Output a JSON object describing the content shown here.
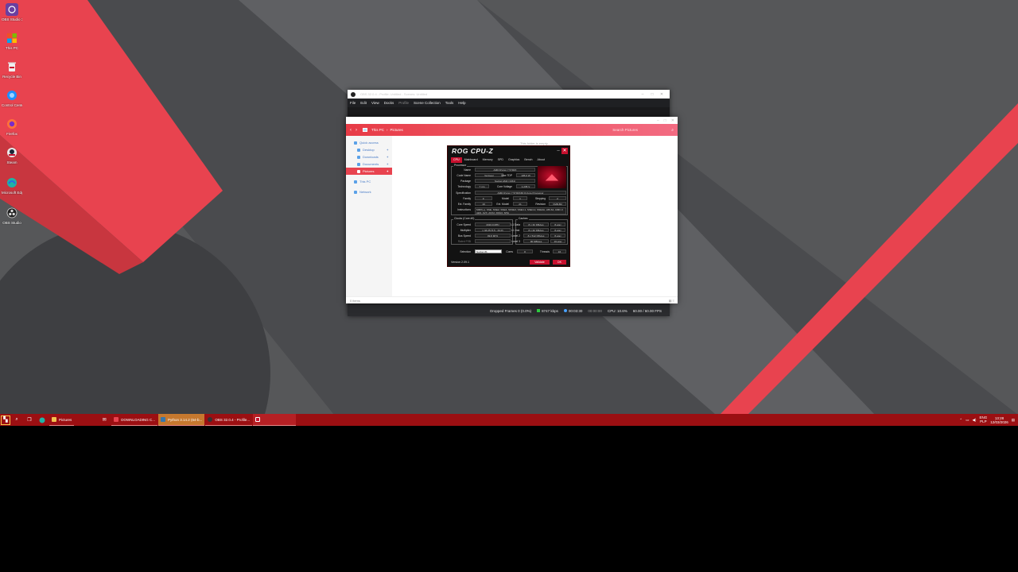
{
  "desktop": {
    "icons": [
      {
        "label": "OBS Studio 32",
        "name": "obs-desktop",
        "color": "#6b3fa0"
      },
      {
        "label": "This PC",
        "name": "this-pc",
        "color": "#f2a81d"
      },
      {
        "label": "Recycle Bin",
        "name": "recycle-bin",
        "color": "#e8e8e8"
      },
      {
        "label": "Control Center",
        "name": "control-center",
        "color": "#1e90ff"
      },
      {
        "label": "Firefox",
        "name": "firefox",
        "color": "#ff7139"
      },
      {
        "label": "Steam",
        "name": "steam",
        "color": "#1b2838"
      },
      {
        "label": "Microsoft Edge",
        "name": "edge",
        "color": "#1fb3a6"
      },
      {
        "label": "OBS Studio",
        "name": "obs-studio",
        "color": "#222"
      }
    ]
  },
  "obs": {
    "title": "OBS 32.0.4 - Profile: Untitled - Scenes: Untitled",
    "menu": [
      "File",
      "Edit",
      "View",
      "Docks",
      "Profile",
      "Scene Collection",
      "Tools",
      "Help"
    ],
    "status": {
      "dropped": "Dropped Frames 0 (0.0%)",
      "bitrate": "8747 kbps",
      "rec_time": "00:03:30",
      "stream_time": "00:00:00",
      "cpu": "CPU: 10.6%",
      "fps": "60.00 / 60.00 FPS"
    }
  },
  "explorer": {
    "path": [
      "This PC",
      "Pictures"
    ],
    "search_placeholder": "Search Pictures",
    "sidebar": [
      {
        "label": "Quick access",
        "sub": false,
        "pin": false,
        "active": false
      },
      {
        "label": "Desktop",
        "sub": true,
        "pin": true,
        "active": false
      },
      {
        "label": "Downloads",
        "sub": true,
        "pin": true,
        "active": false
      },
      {
        "label": "Documents",
        "sub": true,
        "pin": true,
        "active": false
      },
      {
        "label": "Pictures",
        "sub": true,
        "pin": true,
        "active": true
      },
      {
        "label": "This PC",
        "sub": false,
        "pin": false,
        "active": false
      },
      {
        "label": "Network",
        "sub": false,
        "pin": false,
        "active": false
      }
    ],
    "empty_message": "This folder is empty.",
    "status": "0 items"
  },
  "cpuz": {
    "title": "ROG CPU-Z",
    "tabs": [
      "CPU",
      "Mainboard",
      "Memory",
      "SPD",
      "Graphics",
      "Bench",
      "About"
    ],
    "processor_label": "Processor",
    "name_label": "Name",
    "name": "AMD Ryzen 7 5700X",
    "codename_label": "Code Name",
    "codename": "Vermeer",
    "maxtdp_label": "Max TDP",
    "maxtdp": "105.0 W",
    "package_label": "Package",
    "package": "Socket AM4 (1331)",
    "technology_label": "Technology",
    "technology": "7 nm",
    "voltage_label": "Core Voltage",
    "voltage": "1.235 V",
    "spec_label": "Specification",
    "spec": "AMD Ryzen 7 5700X3D 8-Core Processor",
    "family_label": "Family",
    "family": "F",
    "model_label": "Model",
    "model": "1",
    "stepping_label": "Stepping",
    "stepping": "2",
    "extfamily_label": "Ext. Family",
    "extfamily": "19",
    "extmodel_label": "Ext. Model",
    "extmodel": "21",
    "revision_label": "Revision",
    "revision": "VMR-B2",
    "instr_label": "Instructions",
    "instr": "MMX(+), SSE, SSE2, SSE3, SSSE3, SSE4.1, SSE4.2, SSE4A, x86-64, AMD-V, AES, AVX, AVX2, FMA3, SHA",
    "clocks_label": "Clocks (Core #0)",
    "corespeed_label": "Core Speed",
    "corespeed": "4316.9 MHz",
    "multiplier_label": "Multiplier",
    "multiplier": "x 43.25 (5.5 - 34.0)",
    "busspeed_label": "Bus Speed",
    "busspeed": "99.8 MHz",
    "ratedfsb_label": "Rated FSB",
    "caches_label": "Caches",
    "l1d_label": "L1 Data",
    "l1d": "8 x 32 KBytes",
    "l1d_way": "8-way",
    "l1i_label": "L1 Inst.",
    "l1i": "8 x 32 KBytes",
    "l1i_way": "8-way",
    "l2_label": "Level 2",
    "l2": "8 x 512 KBytes",
    "l2_way": "8-way",
    "l3_label": "Level 3",
    "l3": "96 MBytes",
    "l3_way": "16-way",
    "selection_label": "Selection",
    "selection": "Socket #1",
    "cores_label": "Cores",
    "cores": "8",
    "threads_label": "Threads",
    "threads": "16",
    "version": "Version 2.09.1",
    "validate": "Validate",
    "ok": "OK"
  },
  "taskbar": {
    "apps": [
      {
        "label": "Pictures",
        "color": "#f2c14e",
        "style": ""
      },
      {
        "label": "DOWNLOADING C...",
        "color": "#e8434f",
        "style": ""
      },
      {
        "label": "Python 3.14.2 (64-b...",
        "color": "#3776ab",
        "style": "active"
      },
      {
        "label": "OBS 32.0.4 - Profile...",
        "color": "#333",
        "style": ""
      },
      {
        "label": "",
        "color": "#c8102e",
        "style": "sel"
      }
    ],
    "lang_top": "ENG",
    "lang_bottom": "PLP",
    "time": "13:28",
    "date": "12/03/2026"
  }
}
